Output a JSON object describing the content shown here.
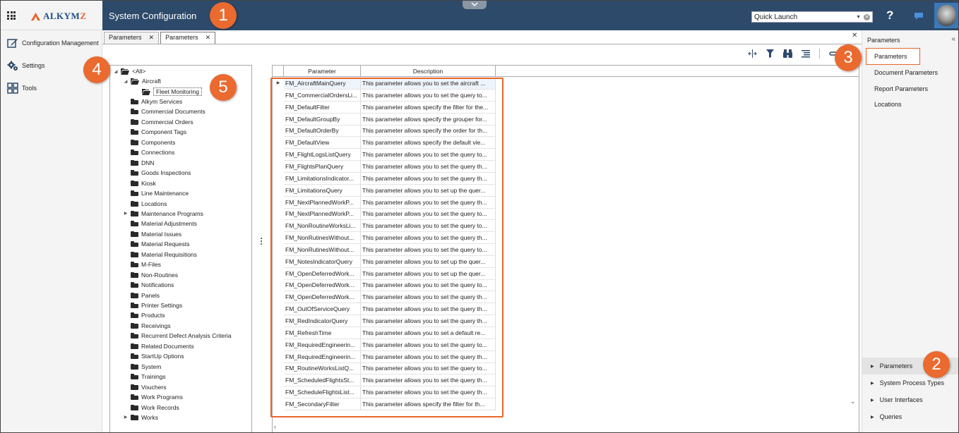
{
  "header": {
    "brand": "ALKYM",
    "brand_accent": "Z",
    "title": "System Configuration",
    "quick_launch_value": "Quick Launch",
    "help_label": "?"
  },
  "leftnav": {
    "items": [
      {
        "label": "Configuration Management",
        "icon": "edit-icon"
      },
      {
        "label": "Settings",
        "icon": "gears-icon"
      },
      {
        "label": "Tools",
        "icon": "tools-grid-icon"
      }
    ]
  },
  "tabs": [
    {
      "label": "Parameters",
      "active": false
    },
    {
      "label": "Parameters",
      "active": true
    }
  ],
  "tree": {
    "root": "<All>",
    "aircraft": "Aircraft",
    "selected": "Fleet Monitoring",
    "items": [
      "Alkym Services",
      "Commercial Documents",
      "Commercial Orders",
      "Component Tags",
      "Components",
      "Connections",
      "DNN",
      "Goods Inspections",
      "Kiosk",
      "Line Maintenance",
      "Locations",
      "Maintenance Programs",
      "Material Adjustments",
      "Material Issues",
      "Material Requests",
      "Material Requisitions",
      "M-Files",
      "Non-Routines",
      "Notifications",
      "Panels",
      "Printer Settings",
      "Products",
      "Receivings",
      "Recurrent Defect Analysis Criteria",
      "Related Documents",
      "StartUp Options",
      "System",
      "Trainings",
      "Vouchers",
      "Work Programs",
      "Work Records",
      "Works"
    ],
    "expandable": [
      "Maintenance Programs",
      "Works"
    ]
  },
  "grid": {
    "columns": [
      "Parameter",
      "Description"
    ],
    "rows": [
      [
        "FM_AircraftMainQuery",
        "This parameter allows you to set the aircraft ..."
      ],
      [
        "FM_CommercialOrdersLi...",
        "This parameter allows you to set the query to..."
      ],
      [
        "FM_DefaultFilter",
        "This parameter allows specify the filter for the..."
      ],
      [
        "FM_DefaultGroupBy",
        "This parameter allows specify the grouper for..."
      ],
      [
        "FM_DefaultOrderBy",
        "This parameter allows specify the order for th..."
      ],
      [
        "FM_DefaultView",
        "This parameter allows specify the default vie..."
      ],
      [
        "FM_FlightLogsListQuery",
        "This parameter allows you to set the query to..."
      ],
      [
        "FM_FlightsPlanQuery",
        "This parameter allows you to set the query th..."
      ],
      [
        "FM_LimitationsIndicator...",
        "This parameter allows you to set the query th..."
      ],
      [
        "FM_LimitationsQuery",
        "This parameter allows you to set up the quer..."
      ],
      [
        "FM_NextPlannedWorkP...",
        "This parameter allows you to set the query th..."
      ],
      [
        "FM_NextPlannedWorkP...",
        "This parameter allows you to set the query to..."
      ],
      [
        "FM_NonRoutineWorksLi...",
        "This parameter allows you to set the query to..."
      ],
      [
        "FM_NonRutinesWithout...",
        "This parameter allows you to set the query th..."
      ],
      [
        "FM_NonRutinesWithout...",
        "This parameter allows you to set the query to..."
      ],
      [
        "FM_NotesIndicatorQuery",
        "This parameter allows you to set up the quer..."
      ],
      [
        "FM_OpenDeferredWork...",
        "This parameter allows you to set up the quer..."
      ],
      [
        "FM_OpenDeferredWork...",
        "This parameter allows you to set the query to..."
      ],
      [
        "FM_OpenDeferredWork...",
        "This parameter allows you to set the query th..."
      ],
      [
        "FM_OutOfServiceQuery",
        "This parameter allows you to set the query th..."
      ],
      [
        "FM_RedIndicatorQuery",
        "This parameter allows you to set the query th..."
      ],
      [
        "FM_RefreshTime",
        "This parameter allows you to set a default re..."
      ],
      [
        "FM_RequiredEngineerin...",
        "This parameter allows you to set the query to..."
      ],
      [
        "FM_RequiredEngineerin...",
        "This parameter allows you to set the query th..."
      ],
      [
        "FM_RoutineWorksListQ...",
        "This parameter allows you to set the query to..."
      ],
      [
        "FM_ScheduledFlightsSt...",
        "This parameter allows you to set the query th..."
      ],
      [
        "FM_ScheduleFlightsList...",
        "This parameter allows you to set the query th..."
      ],
      [
        "FM_SecondaryFilter",
        "This parameter allows specify the filter for th..."
      ]
    ]
  },
  "rightpanel": {
    "title": "Parameters",
    "items": [
      "Parameters",
      "Document Parameters",
      "Report Parameters",
      "Locations"
    ],
    "bottom_items": [
      "Parameters",
      "System Process Types",
      "User Interfaces",
      "Queries"
    ]
  },
  "callouts": [
    "1",
    "2",
    "3",
    "4",
    "5"
  ],
  "colors": {
    "topbar": "#2d4a6b",
    "accent": "#e8672b",
    "brand": "#1f4f86",
    "avatar_bg": "#3d78b5"
  }
}
